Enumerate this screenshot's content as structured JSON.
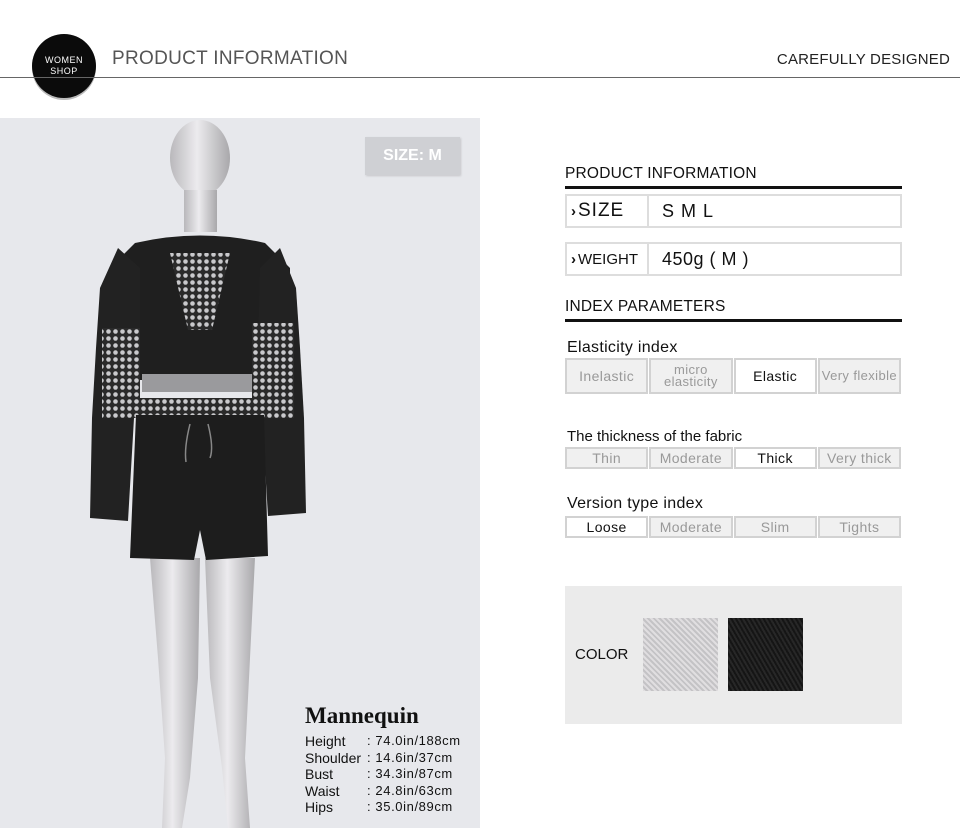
{
  "header": {
    "logo_line1": "WOMEN",
    "logo_line2": "SHOP",
    "title": "PRODUCT INFORMATION",
    "tagline": "CAREFULLY DESIGNED"
  },
  "photo": {
    "size_badge": "SIZE: M",
    "mannequin": {
      "title": "Mannequin",
      "rows": [
        {
          "label": "Height",
          "value": ": 74.0in/188cm"
        },
        {
          "label": "Shoulder",
          "value": ": 14.6in/37cm"
        },
        {
          "label": "Bust",
          "value": ": 34.3in/87cm"
        },
        {
          "label": "Waist",
          "value": ": 24.8in/63cm"
        },
        {
          "label": "Hips",
          "value": ": 35.0in/89cm"
        }
      ]
    }
  },
  "product_info": {
    "title": "PRODUCT INFORMATION",
    "size_label": "SIZE",
    "size_value": "S M L",
    "weight_label": "WEIGHT",
    "weight_value": "450g ( M )"
  },
  "index_parameters": {
    "title": "INDEX PARAMETERS",
    "elasticity": {
      "label": "Elasticity index",
      "options": [
        "Inelastic",
        "micro elasticity",
        "Elastic",
        "Very flexible"
      ],
      "selected": "Elastic"
    },
    "thickness": {
      "label": "The thickness of the fabric",
      "options": [
        "Thin",
        "Moderate",
        "Thick",
        "Very thick"
      ],
      "selected": "Thick"
    },
    "version": {
      "label": "Version type index",
      "options": [
        "Loose",
        "Moderate",
        "Slim",
        "Tights"
      ],
      "selected": "Loose"
    }
  },
  "colors": {
    "label": "COLOR",
    "swatches": [
      {
        "name": "grey",
        "hex": "#cfcdd0"
      },
      {
        "name": "black",
        "hex": "#1a1a1a"
      }
    ]
  }
}
